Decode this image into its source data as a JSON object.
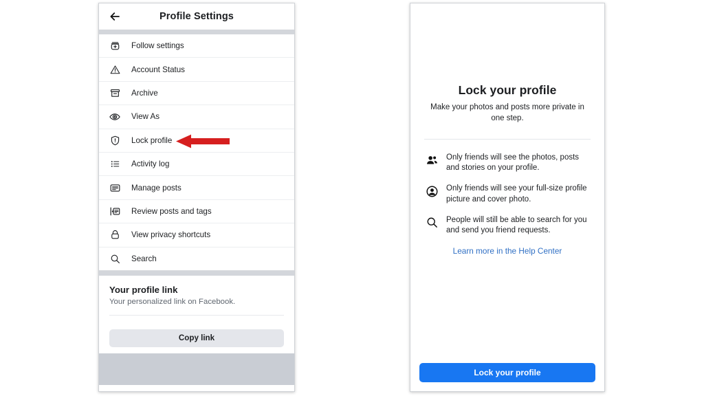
{
  "left_phone": {
    "header": {
      "back_icon": "back-arrow-icon",
      "title": "Profile Settings"
    },
    "menu_items": [
      {
        "icon": "follow-settings-icon",
        "label": "Follow settings"
      },
      {
        "icon": "warning-triangle-icon",
        "label": "Account Status"
      },
      {
        "icon": "archive-box-icon",
        "label": "Archive"
      },
      {
        "icon": "eye-icon",
        "label": "View As"
      },
      {
        "icon": "shield-lock-icon",
        "label": "Lock profile"
      },
      {
        "icon": "activity-list-icon",
        "label": "Activity log"
      },
      {
        "icon": "manage-posts-icon",
        "label": "Manage posts"
      },
      {
        "icon": "review-posts-icon",
        "label": "Review posts and tags"
      },
      {
        "icon": "padlock-icon",
        "label": "View privacy shortcuts"
      },
      {
        "icon": "search-icon",
        "label": "Search"
      }
    ],
    "annotation": {
      "icon": "red-left-arrow-annotation",
      "color": "#d61f1f",
      "points_to": "Lock profile"
    },
    "profile_link_card": {
      "title": "Your profile link",
      "subtitle": "Your personalized link on Facebook.",
      "copy_button": "Copy link"
    }
  },
  "right_phone": {
    "title": "Lock your profile",
    "subtitle": "Make your photos and posts more private in one step.",
    "bullets": [
      {
        "icon": "people-icon",
        "text": "Only friends will see the photos, posts and stories on your profile."
      },
      {
        "icon": "person-circle-icon",
        "text": "Only friends will see your full-size profile picture and cover photo."
      },
      {
        "icon": "search-icon",
        "text": "People will still be able to search for you and send you friend requests."
      }
    ],
    "help_link": "Learn more in the Help Center",
    "primary_button": "Lock your profile"
  },
  "colors": {
    "facebook_blue": "#1877f2",
    "link_blue": "#2f6fc4",
    "annotation_red": "#d61f1f",
    "gray_band": "#d3d6db",
    "bottom_gray": "#c9cdd4",
    "button_gray": "#e4e6eb"
  }
}
